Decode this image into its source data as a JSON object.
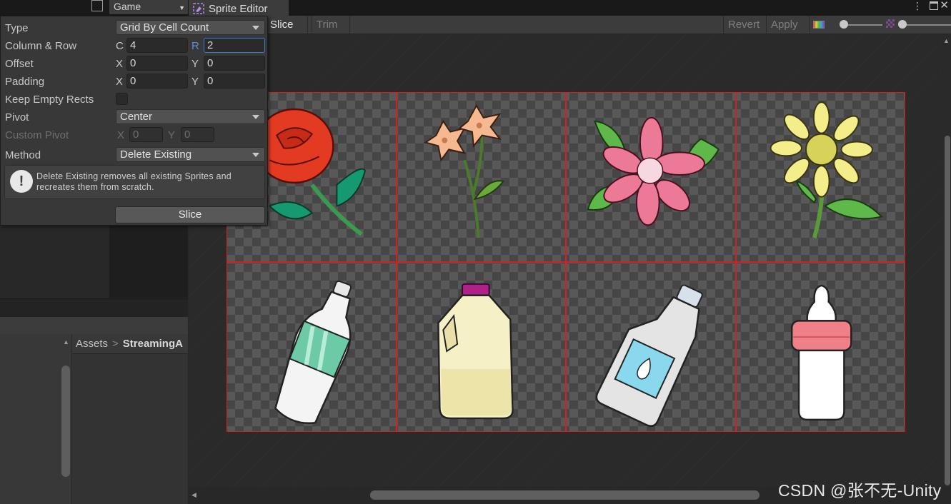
{
  "window": {
    "game_tab_label": "Game",
    "sprite_editor_tab_label": "Sprite Editor",
    "menu_glyph": "⋮",
    "close_glyph": "✕"
  },
  "toolbar": {
    "slice_label": "Slice",
    "trim_label": "Trim",
    "revert_label": "Revert",
    "apply_label": "Apply"
  },
  "slice_popup": {
    "type_label": "Type",
    "type_value": "Grid By Cell Count",
    "column_row_label": "Column & Row",
    "column_axis": "C",
    "column_value": "4",
    "row_axis": "R",
    "row_value": "2",
    "offset_label": "Offset",
    "offset_x_axis": "X",
    "offset_x": "0",
    "offset_y_axis": "Y",
    "offset_y": "0",
    "padding_label": "Padding",
    "padding_x_axis": "X",
    "padding_x": "0",
    "padding_y_axis": "Y",
    "padding_y": "0",
    "keep_empty_label": "Keep Empty Rects",
    "keep_empty_checked": false,
    "pivot_label": "Pivot",
    "pivot_value": "Center",
    "custom_pivot_label": "Custom Pivot",
    "custom_pivot_x_axis": "X",
    "custom_pivot_x": "0",
    "custom_pivot_y_axis": "Y",
    "custom_pivot_y": "0",
    "method_label": "Method",
    "method_value": "Delete Existing",
    "help_icon_glyph": "!",
    "help_text": "Delete Existing removes all existing Sprites and recreates them from scratch.",
    "slice_button_label": "Slice"
  },
  "project": {
    "breadcrumb_root": "Assets",
    "breadcrumb_sep": ">",
    "breadcrumb_current": "StreamingA"
  },
  "sprite_sheet": {
    "columns": 4,
    "rows": 2,
    "grid_color": "#d42020",
    "sprites": [
      "rose",
      "lily",
      "pink-flower",
      "sunflower",
      "water-bottle",
      "milk-jug",
      "detergent-bottle",
      "baby-bottle"
    ]
  },
  "watermark": "CSDN @张不无-Unity"
}
